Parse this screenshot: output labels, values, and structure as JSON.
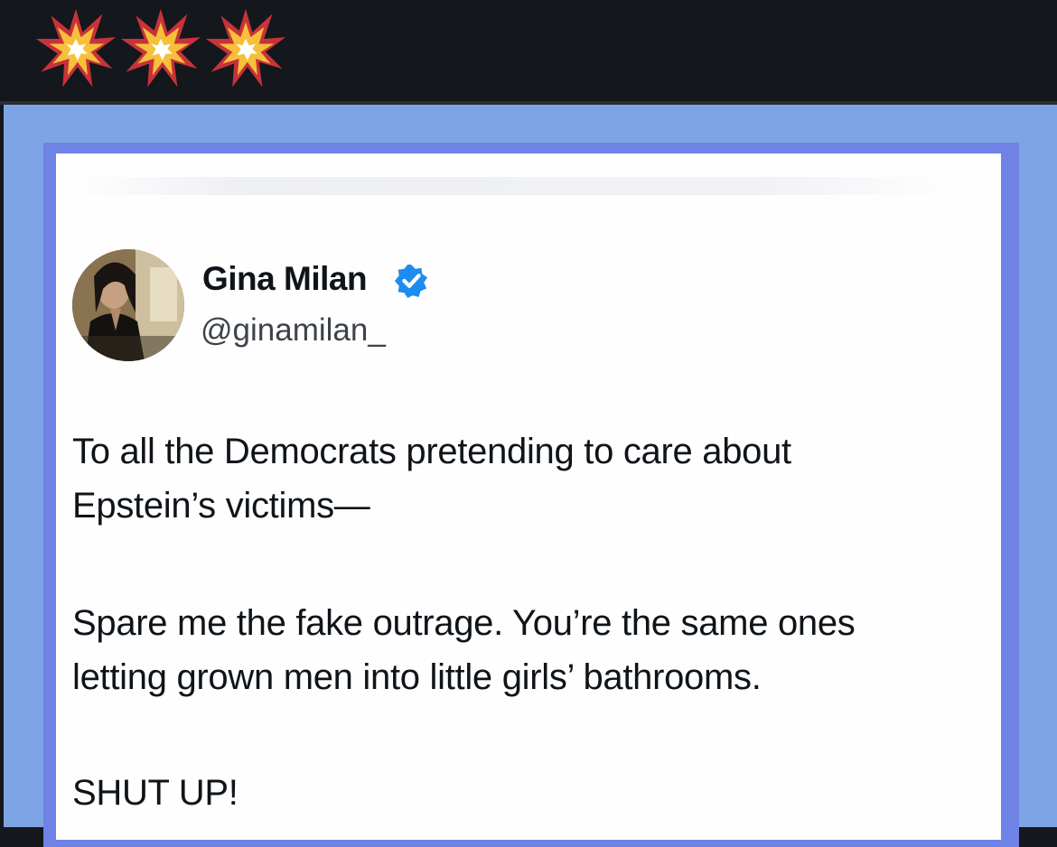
{
  "header": {
    "emoji": [
      "collision-emoji",
      "collision-emoji",
      "collision-emoji"
    ]
  },
  "colors": {
    "background_dark": "#14171c",
    "frame_light_blue": "#7fa4e6",
    "frame_periwinkle": "#6f82e6",
    "card_white": "#fefefe",
    "verified_blue": "#1d8cf0",
    "burst_red": "#c8323a",
    "burst_yellow": "#f6c03a"
  },
  "tweet": {
    "display_name": "Gina Milan",
    "handle": "@ginamilan_",
    "verified_icon": "verified-badge-icon",
    "paragraphs": [
      [
        "To all the Democrats pretending to care about",
        "Epstein’s victims—"
      ],
      [
        "Spare me the fake outrage. You’re the same ones",
        "letting grown men into little girls’ bathrooms."
      ],
      [
        "SHUT UP!"
      ]
    ]
  }
}
